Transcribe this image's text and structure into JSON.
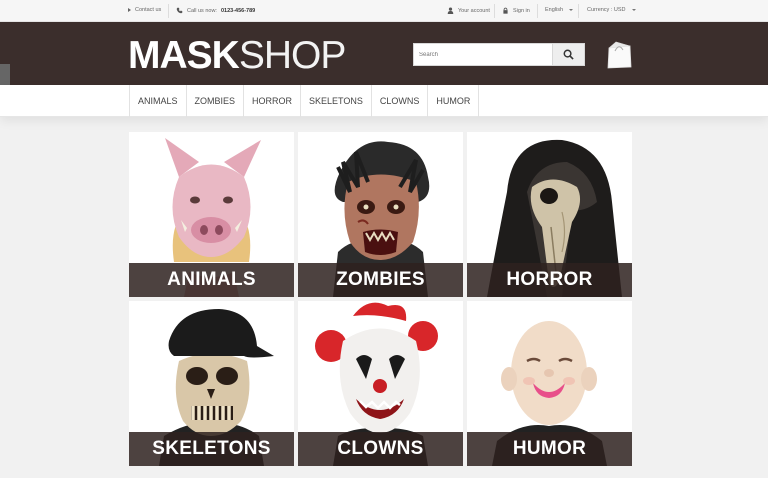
{
  "topbar": {
    "contact": "Contact us",
    "call_prefix": "Call us now:",
    "phone": "0123-456-789",
    "account": "Your account",
    "signin": "Sign in",
    "language": "English",
    "currency": "Currency : USD"
  },
  "logo": {
    "bold": "MASK",
    "thin": "SHOP"
  },
  "search": {
    "placeholder": "Search"
  },
  "nav": {
    "items": [
      "Animals",
      "Zombies",
      "Horror",
      "Skeletons",
      "Clowns",
      "Humor"
    ]
  },
  "categories": [
    {
      "label": "ANIMALS",
      "image": "pig-mask"
    },
    {
      "label": "ZOMBIES",
      "image": "zombie-mask"
    },
    {
      "label": "HORROR",
      "image": "plague-bird-skull-mask"
    },
    {
      "label": "SKELETONS",
      "image": "skull-cap-mask"
    },
    {
      "label": "CLOWNS",
      "image": "clown-mask"
    },
    {
      "label": "HUMOR",
      "image": "baby-face-mask"
    }
  ],
  "colors": {
    "header_bg": "#3b2e2c",
    "label_bg": "#2e211f",
    "page_bg": "#f1f1f1"
  }
}
